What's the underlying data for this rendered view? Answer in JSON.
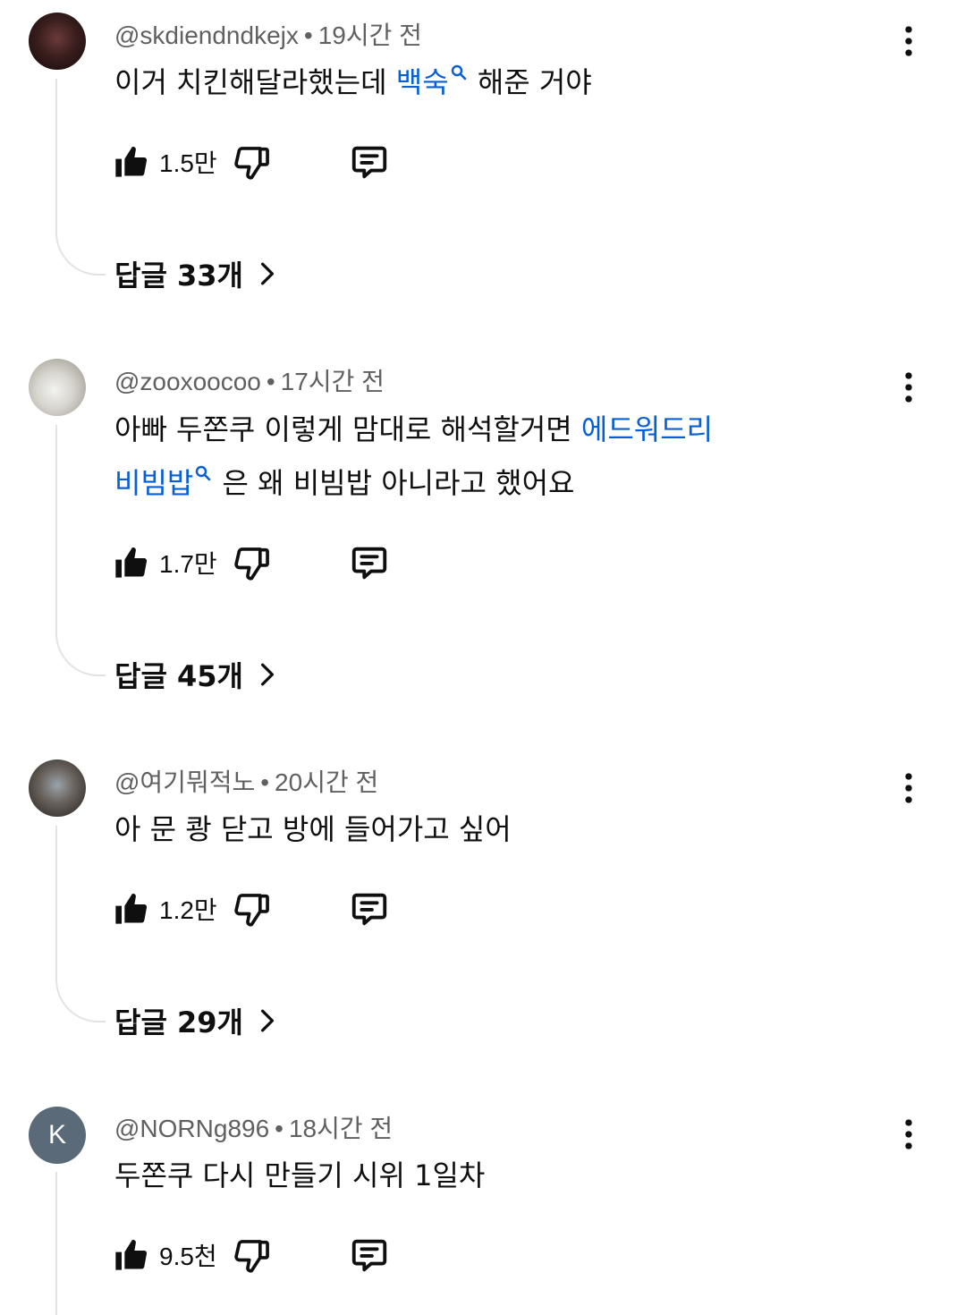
{
  "comments": [
    {
      "handle": "@skdiendndkejx",
      "dot": "•",
      "time": "19시간 전",
      "text_before": "이거 치킨해달라했는데 ",
      "link": "백숙",
      "text_after": " 해준 거야",
      "likes": "1.5만",
      "replies": "답글 33개"
    },
    {
      "handle": "@zooxoocoo",
      "dot": "•",
      "time": "17시간 전",
      "line1_text": "아빠 두쫀쿠 이렇게 맘대로 해석할거면 ",
      "line1_link": "에드워드리",
      "line2_link": "비빔밥",
      "line2_text": " 은 왜 비빔밥 아니라고 했어요",
      "likes": "1.7만",
      "replies": "답글 45개"
    },
    {
      "handle": "@여기뭐적노",
      "dot": "•",
      "time": "20시간 전",
      "text": "아 문 쾅 닫고 방에 들어가고 싶어",
      "likes": "1.2만",
      "replies": "답글 29개"
    },
    {
      "handle": "@NORNg896",
      "dot": "•",
      "time": "18시간 전",
      "avatar_letter": "K",
      "text": "두쫀쿠 다시 만들기 시위 1일차",
      "likes": "9.5천"
    }
  ]
}
